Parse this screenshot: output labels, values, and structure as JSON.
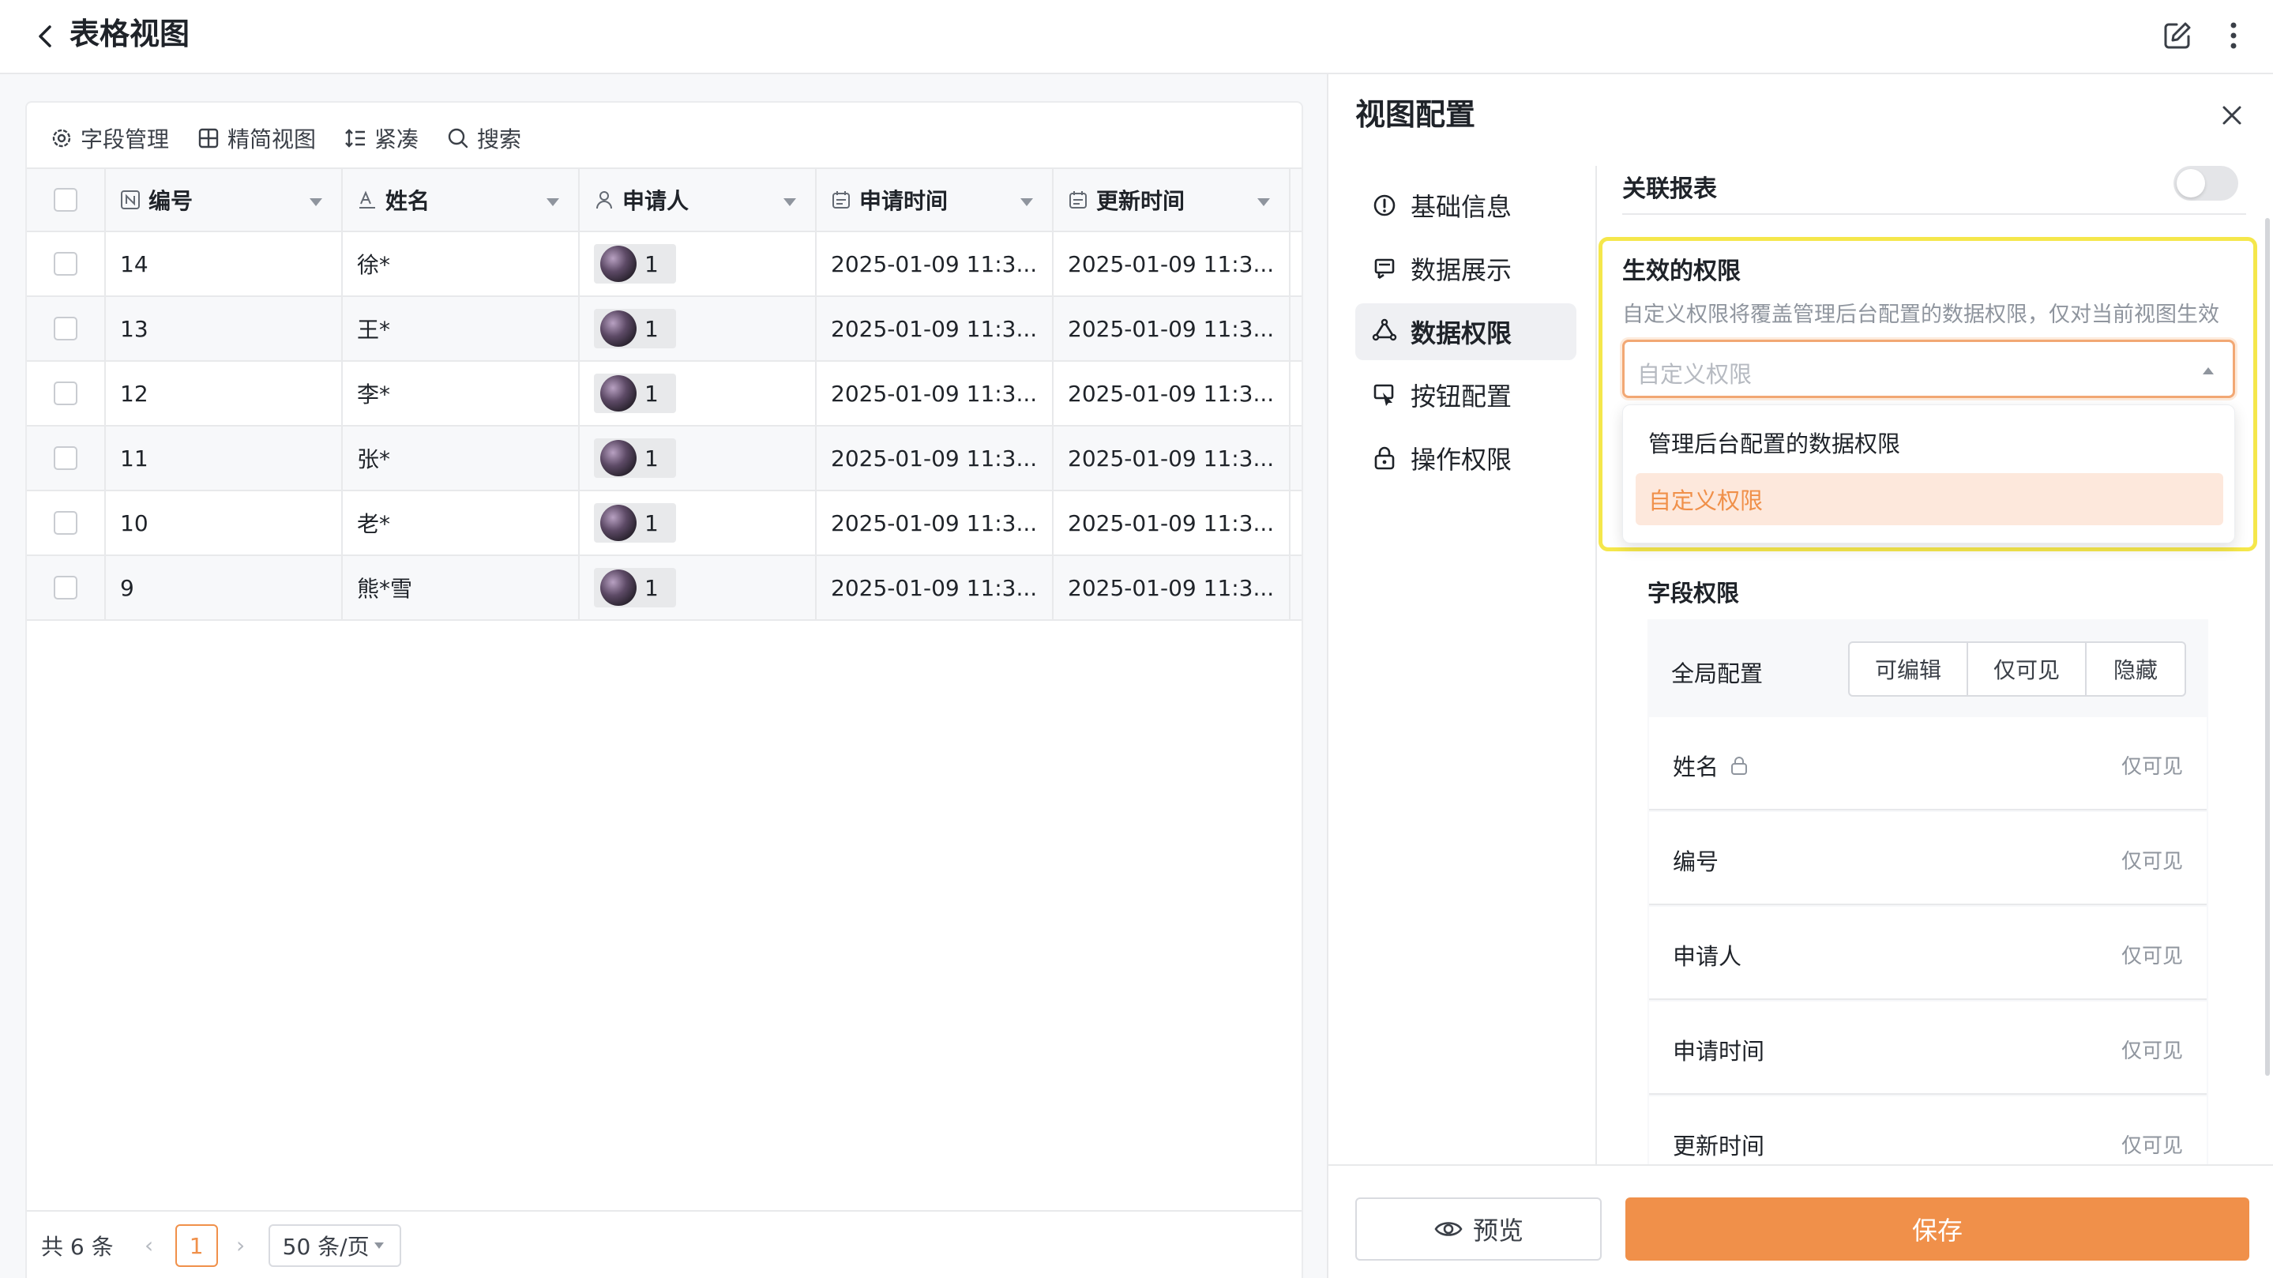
{
  "header": {
    "title": "表格视图"
  },
  "toolbar": {
    "field_manage": "字段管理",
    "compact_view": "精简视图",
    "density": "紧凑",
    "search": "搜索"
  },
  "table": {
    "columns": [
      "编号",
      "姓名",
      "申请人",
      "申请时间",
      "更新时间"
    ],
    "rows": [
      {
        "id": "14",
        "name": "徐*",
        "applicant": "1",
        "apply_time": "2025-01-09 11:3...",
        "update_time": "2025-01-09 11:3..."
      },
      {
        "id": "13",
        "name": "王*",
        "applicant": "1",
        "apply_time": "2025-01-09 11:3...",
        "update_time": "2025-01-09 11:3..."
      },
      {
        "id": "12",
        "name": "李*",
        "applicant": "1",
        "apply_time": "2025-01-09 11:3...",
        "update_time": "2025-01-09 11:3..."
      },
      {
        "id": "11",
        "name": "张*",
        "applicant": "1",
        "apply_time": "2025-01-09 11:3...",
        "update_time": "2025-01-09 11:3..."
      },
      {
        "id": "10",
        "name": "老*",
        "applicant": "1",
        "apply_time": "2025-01-09 11:3...",
        "update_time": "2025-01-09 11:3..."
      },
      {
        "id": "9",
        "name": "熊*雪",
        "applicant": "1",
        "apply_time": "2025-01-09 11:3...",
        "update_time": "2025-01-09 11:3..."
      }
    ]
  },
  "pagination": {
    "total": "共 6 条",
    "prev": "‹",
    "current": "1",
    "next": "›",
    "page_size": "50 条/页"
  },
  "panel": {
    "title": "视图配置",
    "menu": [
      {
        "label": "基础信息",
        "icon": "info-icon"
      },
      {
        "label": "数据展示",
        "icon": "display-icon"
      },
      {
        "label": "数据权限",
        "icon": "data-permission-icon",
        "active": true
      },
      {
        "label": "按钮配置",
        "icon": "button-config-icon"
      },
      {
        "label": "操作权限",
        "icon": "lock-icon"
      }
    ],
    "related_report": {
      "label": "关联报表",
      "enabled": false
    },
    "effective": {
      "title": "生效的权限",
      "desc": "自定义权限将覆盖管理后台配置的数据权限，仅对当前视图生效",
      "placeholder": "自定义权限",
      "options": [
        "管理后台配置的数据权限",
        "自定义权限"
      ],
      "hovered_option": "自定义权限"
    },
    "field_permission": {
      "title": "字段权限",
      "global_label": "全局配置",
      "segments": [
        "可编辑",
        "仅可见",
        "隐藏"
      ],
      "fields": [
        {
          "name": "姓名",
          "value": "仅可见",
          "locked": true
        },
        {
          "name": "编号",
          "value": "仅可见"
        },
        {
          "name": "申请人",
          "value": "仅可见"
        },
        {
          "name": "申请时间",
          "value": "仅可见"
        },
        {
          "name": "更新时间",
          "value": "仅可见"
        }
      ]
    },
    "buttons": {
      "preview": "预览",
      "save": "保存"
    }
  },
  "colors": {
    "accent": "#f0904a",
    "highlight_border": "#f5e74b",
    "option_hover_bg": "#fde8dc"
  }
}
